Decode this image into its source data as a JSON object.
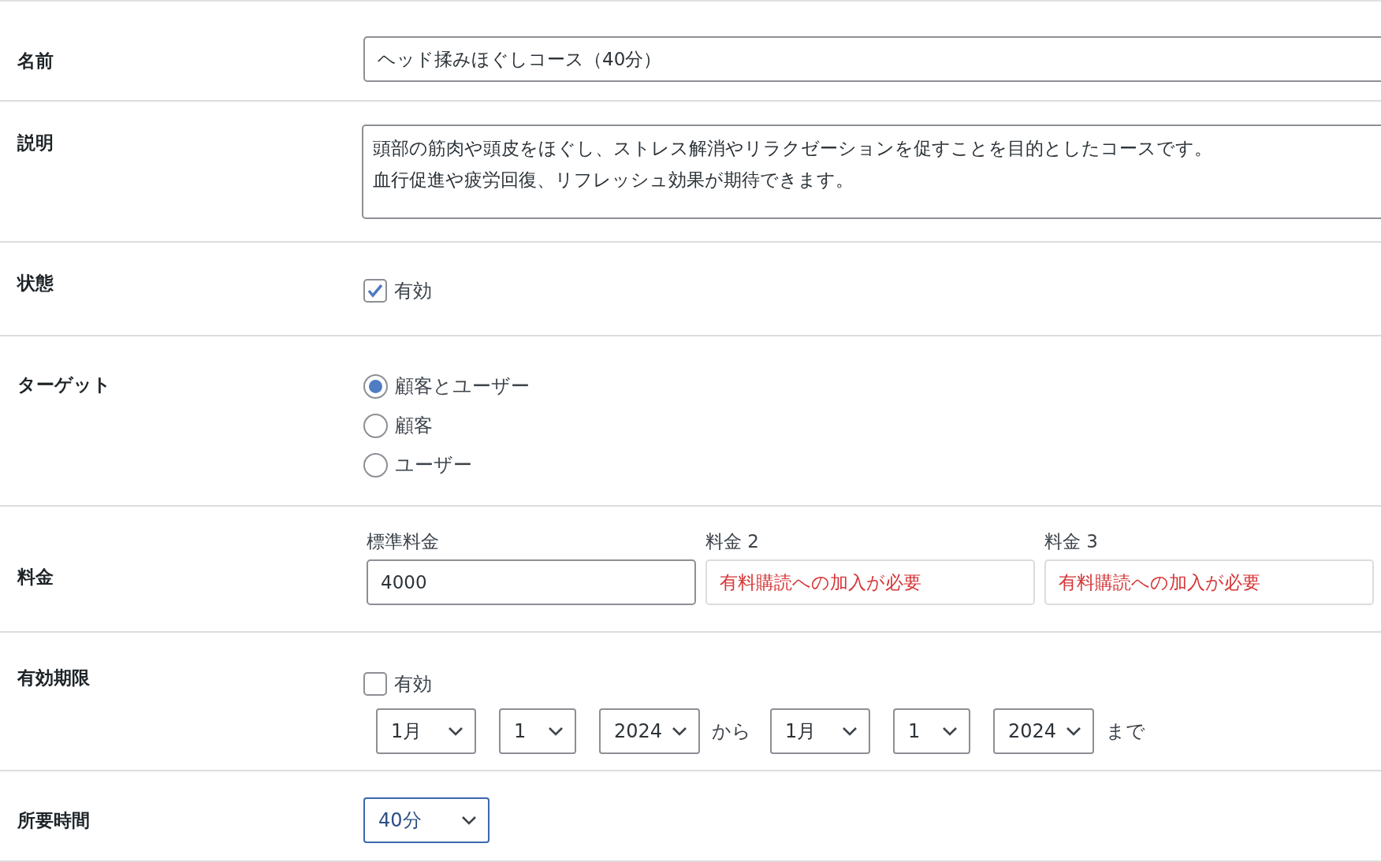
{
  "rows": [
    {
      "kind": "text",
      "label": "名前",
      "value": "ヘッド揉みほぐしコース（40分）"
    },
    {
      "kind": "textarea",
      "label": "説明",
      "lines": [
        "頭部の筋肉や頭皮をほぐし、ストレス解消やリラクゼーションを促すことを目的としたコースです。",
        "血行促進や疲労回復、リフレッシュ効果が期待できます。"
      ]
    },
    {
      "kind": "checkbox",
      "label": "状態",
      "option": {
        "label": "有効",
        "checked": true
      }
    },
    {
      "kind": "radio",
      "label": "ターゲット",
      "options": [
        {
          "label": "顧客とユーザー",
          "selected": true
        },
        {
          "label": "顧客",
          "selected": false
        },
        {
          "label": "ユーザー",
          "selected": false
        }
      ]
    },
    {
      "kind": "prices",
      "label": "料金",
      "prices": [
        {
          "label": "標準料金",
          "value": "4000",
          "disabled": false
        },
        {
          "label": "料金 2",
          "placeholder": "有料購読への加入が必要",
          "disabled": true
        },
        {
          "label": "料金 3",
          "placeholder": "有料購読への加入が必要",
          "disabled": true
        }
      ]
    },
    {
      "kind": "period",
      "label": "有効期限",
      "option": {
        "label": "有効",
        "checked": false
      },
      "from": [
        "1月",
        "1",
        "2024"
      ],
      "from_text": "から",
      "to": [
        "1月",
        "1",
        "2024"
      ],
      "to_text": "まで"
    },
    {
      "kind": "select",
      "label": "所要時間",
      "value": "40分",
      "focused": true
    }
  ]
}
